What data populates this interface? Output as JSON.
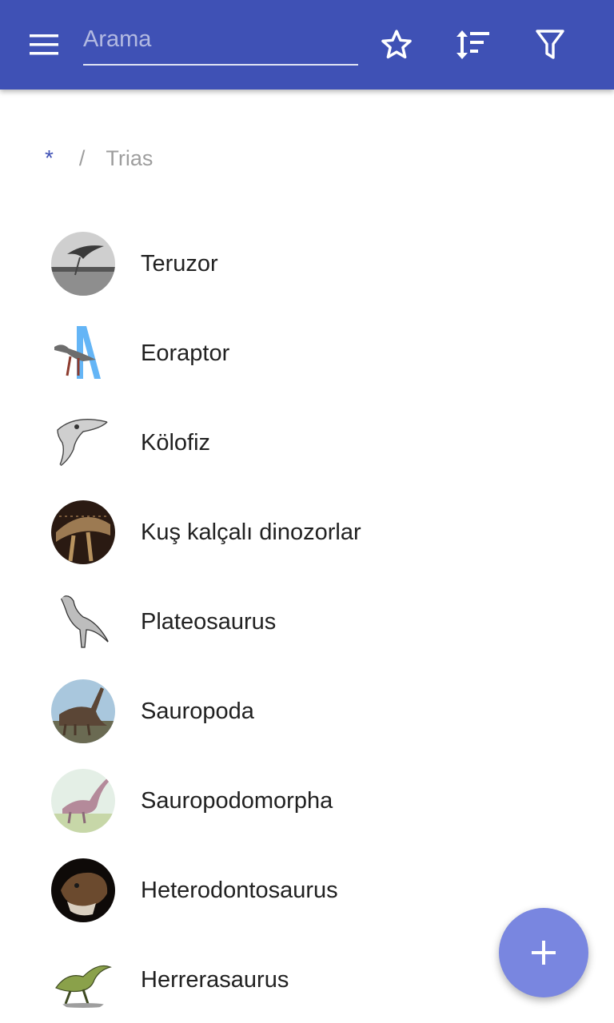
{
  "search": {
    "placeholder": "Arama",
    "value": ""
  },
  "toolbar": {
    "menu_icon": "menu-icon",
    "favorite_icon": "star-outline-icon",
    "sort_icon": "sort-icon",
    "filter_icon": "filter-icon"
  },
  "breadcrumb": {
    "root": "*",
    "separator": "/",
    "current": "Trias"
  },
  "items": [
    {
      "label": "Teruzor"
    },
    {
      "label": "Eoraptor"
    },
    {
      "label": "Kölofiz"
    },
    {
      "label": "Kuş kalçalı dinozorlar"
    },
    {
      "label": "Plateosaurus"
    },
    {
      "label": "Sauropoda"
    },
    {
      "label": "Sauropodomorpha"
    },
    {
      "label": "Heterodontosaurus"
    },
    {
      "label": "Herrerasaurus"
    }
  ],
  "fab": {
    "icon": "plus-icon"
  },
  "colors": {
    "primary": "#3f51b5",
    "fab": "#7986e0",
    "text": "#212121",
    "muted": "#9e9e9e"
  }
}
